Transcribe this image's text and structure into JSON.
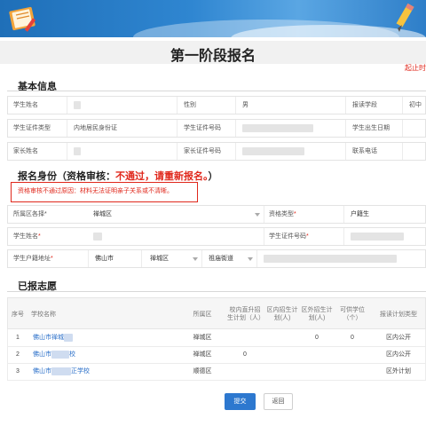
{
  "page": {
    "title": "第一阶段报名",
    "deadline_text": "起止时"
  },
  "basic_info": {
    "heading": "基本信息",
    "rows": [
      [
        {
          "label": "学生姓名",
          "value": ""
        },
        {
          "label": "性别",
          "value": "男"
        },
        {
          "label": "报读学段",
          "value": "初中"
        }
      ],
      [
        {
          "label": "学生证件类型",
          "value": "内地居民身份证"
        },
        {
          "label": "学生证件号码",
          "value": ""
        },
        {
          "label": "学生出生日期",
          "value": ""
        }
      ],
      [
        {
          "label": "家长姓名",
          "value": ""
        },
        {
          "label": "家长证件号码",
          "value": ""
        },
        {
          "label": "联系电话",
          "value": ""
        }
      ]
    ]
  },
  "identity": {
    "heading_prefix": "报名身份（资格审核：",
    "heading_status": "不通过，请重新报名。",
    "heading_suffix": "）",
    "reason": "资格审核不通过原因：材料无法证明亲子关系或不清晰。",
    "form": {
      "area_label": "所属区各择*",
      "area_value": "禅城区",
      "qual_type_label": "资格类型",
      "qual_type_value": "户籍生",
      "name_label": "学生姓名",
      "id_label": "学生证件号码",
      "hukou_label": "学生户籍地址",
      "hukou_city": "佛山市",
      "hukou_district": "禅城区",
      "hukou_street": "祖庙街道"
    }
  },
  "applied": {
    "heading": "已报志愿",
    "columns": [
      "序号",
      "学校名称",
      "所属区",
      "校内直升招生计划（人）",
      "区内招生计划(人)",
      "区外招生计划(人)",
      "可供学位（个）",
      "报读计划类型"
    ],
    "rows": [
      {
        "no": "1",
        "school": "佛山市禅城",
        "district": "禅城区",
        "internal": "",
        "in_district": "",
        "out_district": "0",
        "seats": "0",
        "plan_type": "区内公开"
      },
      {
        "no": "2",
        "school": "佛山市",
        "school_suffix": "校",
        "district": "禅城区",
        "internal": "0",
        "in_district": "",
        "out_district": "",
        "seats": "",
        "plan_type": "区内公开"
      },
      {
        "no": "3",
        "school": "佛山市",
        "school_suffix": "正学校",
        "district": "顺德区",
        "internal": "",
        "in_district": "",
        "out_district": "",
        "seats": "",
        "plan_type": "区外计划"
      }
    ]
  },
  "buttons": {
    "submit": "提交",
    "back": "返回"
  },
  "colors": {
    "primary": "#2d78cf",
    "error": "#e0281c",
    "link": "#2a6fc9"
  }
}
